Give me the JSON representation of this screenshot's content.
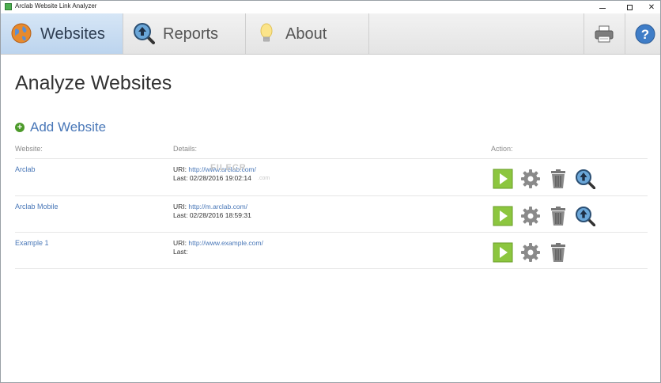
{
  "window": {
    "title": "Arclab Website Link Analyzer"
  },
  "toolbar": {
    "tabs": [
      {
        "label": "Websites",
        "icon": "globe-icon",
        "active": true
      },
      {
        "label": "Reports",
        "icon": "magnifier-icon",
        "active": false
      },
      {
        "label": "About",
        "icon": "lightbulb-icon",
        "active": false
      }
    ],
    "print_icon": "printer-icon",
    "help_icon": "help-icon"
  },
  "main": {
    "title": "Analyze Websites",
    "add_website_label": "Add Website",
    "headers": {
      "website": "Website:",
      "details": "Details:",
      "action": "Action:"
    },
    "rows": [
      {
        "name": "Arclab",
        "url_label": "URI:",
        "url": "http://www.arclab.com/",
        "last_label": "Last:",
        "last": "02/28/2016 19:02:14",
        "has_report": true
      },
      {
        "name": "Arclab Mobile",
        "url_label": "URI:",
        "url": "http://m.arclab.com/",
        "last_label": "Last:",
        "last": "02/28/2016 18:59:31",
        "has_report": true
      },
      {
        "name": "Example 1",
        "url_label": "URI:",
        "url": "http://www.example.com/",
        "last_label": "Last:",
        "last": "",
        "has_report": false
      }
    ]
  },
  "colors": {
    "accent": "#4a78b8",
    "active_tab": "#c5daf1",
    "run_green": "#8cc63f",
    "add_green": "#4c9a2a"
  },
  "watermark": {
    "text": "FILECR",
    "suffix": ".com"
  }
}
